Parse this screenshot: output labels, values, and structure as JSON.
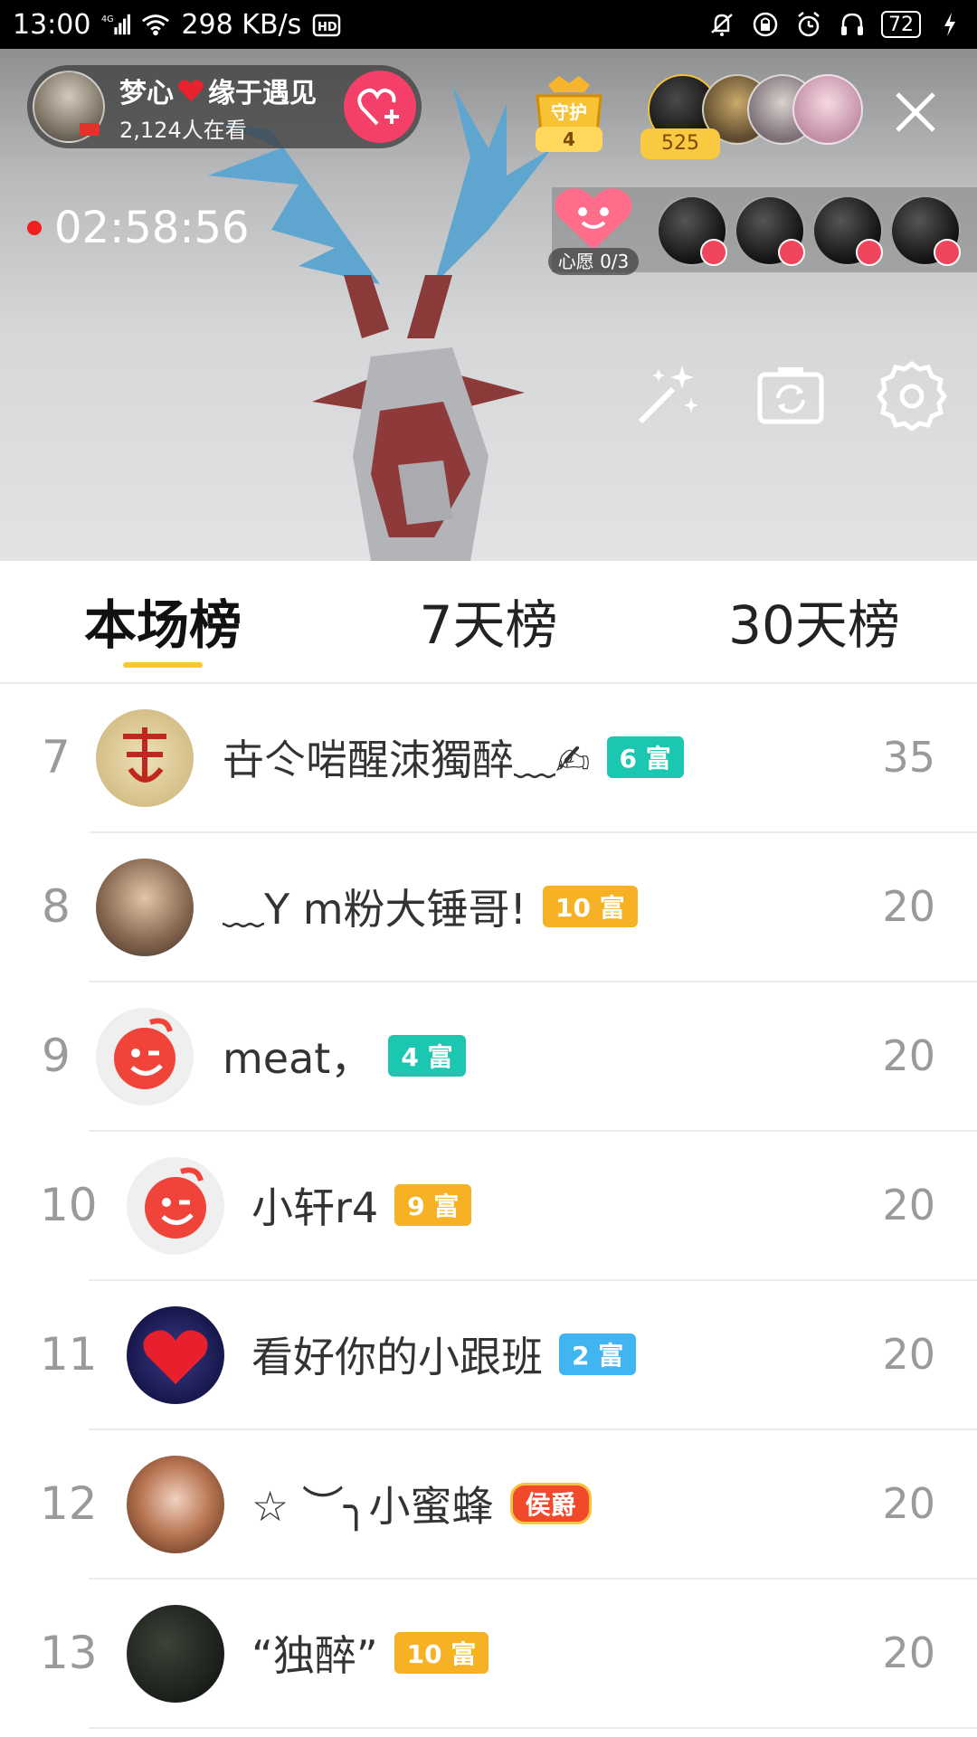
{
  "status_bar": {
    "time": "13:00",
    "network": "4G",
    "speed": "298 KB/s",
    "hd": "HD",
    "battery": "72"
  },
  "live": {
    "host_name": "梦心",
    "host_name_suffix": "缘于遇见",
    "watching": "2,124人在看",
    "guard_label": "守护",
    "guard_count": "4",
    "viewer_count": "525",
    "timer": "02:58:56",
    "wish_label": "心愿 0/3"
  },
  "tabs": [
    {
      "label": "本场榜",
      "active": true
    },
    {
      "label": "7天榜",
      "active": false
    },
    {
      "label": "30天榜",
      "active": false
    }
  ],
  "leaderboard": [
    {
      "rank": "7",
      "name": "卋仒啱醒洓獨醉﹏✍",
      "badge": "6 富",
      "badge_color": "#1cc7b2",
      "score": "35"
    },
    {
      "rank": "8",
      "name": "﹏Y m粉大锤哥!",
      "badge": "10 富",
      "badge_color": "#f6b125",
      "score": "20"
    },
    {
      "rank": "9",
      "name": "meat，",
      "badge": "4 富",
      "badge_color": "#1cc7b2",
      "score": "20"
    },
    {
      "rank": "10",
      "name": "小轩r4",
      "badge": "9 富",
      "badge_color": "#f6b125",
      "score": "20"
    },
    {
      "rank": "11",
      "name": "看好你的小跟班",
      "badge": "2 富",
      "badge_color": "#40b5f2",
      "score": "20"
    },
    {
      "rank": "12",
      "name": "☆ ︶╮小蜜蜂",
      "badge": "侯爵",
      "badge_color": "#f04a2a",
      "score": "20"
    },
    {
      "rank": "13",
      "name": "“独醉”",
      "badge": "10 富",
      "badge_color": "#f6b125",
      "score": "20"
    }
  ]
}
